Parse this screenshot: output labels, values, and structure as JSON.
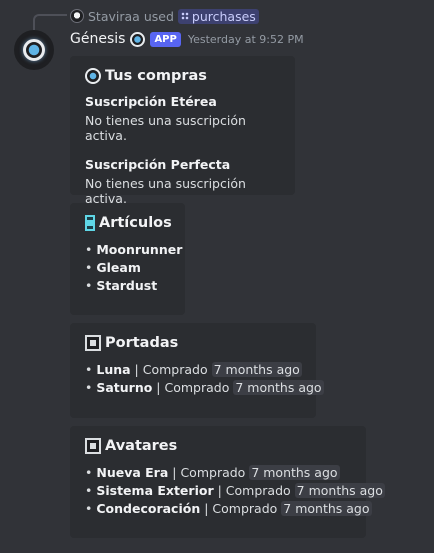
{
  "reply": {
    "user": "Staviraa",
    "used_text": "used",
    "command": "purchases"
  },
  "message": {
    "username": "Génesis",
    "app_tag": "APP",
    "timestamp": "Yesterday at 9:52 PM"
  },
  "embeds": {
    "compras": {
      "title": "Tus compras",
      "fields": [
        {
          "name": "Suscripción Etérea",
          "value": "No tienes una suscripción activa."
        },
        {
          "name": "Suscripción Perfecta",
          "value": "No tienes una suscripción activa."
        }
      ]
    },
    "articulos": {
      "title": "Artículos",
      "items": [
        "Moonrunner",
        "Gleam",
        "Stardust"
      ]
    },
    "portadas": {
      "title": "Portadas",
      "items": [
        {
          "name": "Luna",
          "status": "Comprado",
          "time": "7 months ago"
        },
        {
          "name": "Saturno",
          "status": "Comprado",
          "time": "7 months ago"
        }
      ]
    },
    "avatares": {
      "title": "Avatares",
      "items": [
        {
          "name": "Nueva Era",
          "status": "Comprado",
          "time": "7 months ago"
        },
        {
          "name": "Sistema Exterior",
          "status": "Comprado",
          "time": "7 months ago"
        },
        {
          "name": "Condecoración",
          "status": "Comprado",
          "time": "7 months ago"
        }
      ]
    }
  },
  "colors": {
    "background": "#313338",
    "embed_background": "#2b2d31",
    "accent": "#5865f2",
    "icon_cyan": "#5fd6e6"
  },
  "icons": {
    "avatar": "orb-avatar-icon",
    "compras": "orb-icon",
    "articulos": "cyan-square-icon",
    "portadas": "square-icon",
    "avatares": "square-icon"
  }
}
